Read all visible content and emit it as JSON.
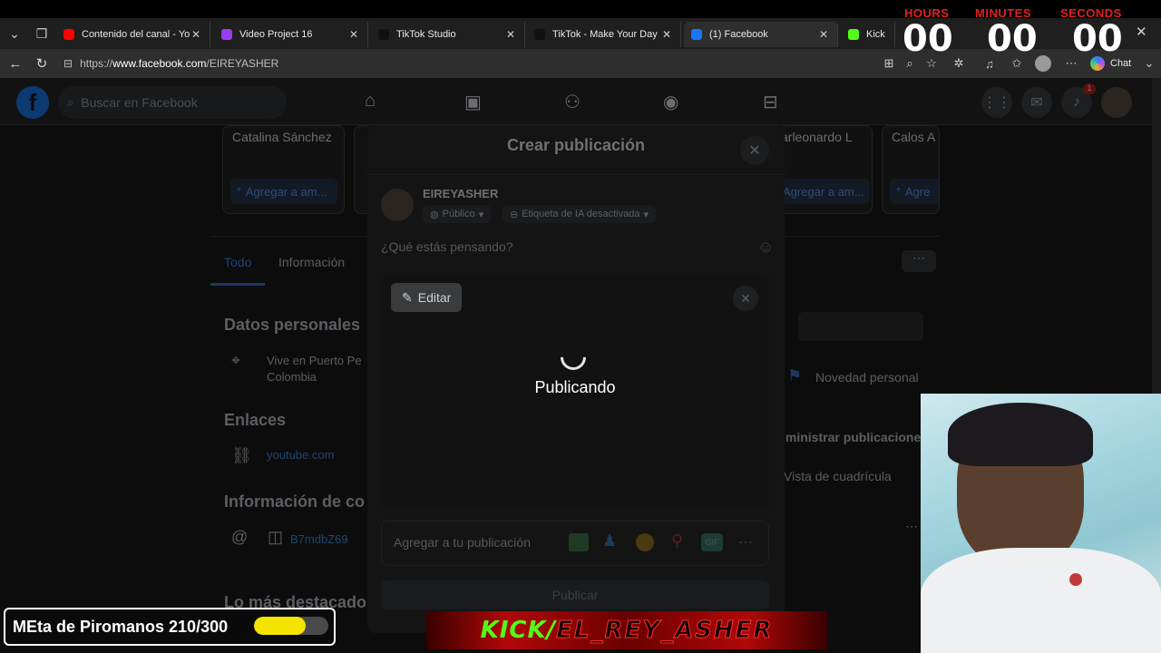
{
  "browser": {
    "tabs": [
      {
        "title": "Contenido del canal - YouTube",
        "favicon_color": "#ff0000",
        "favicon": "youtube-icon"
      },
      {
        "title": "Video Project 16",
        "favicon_color": "#9b3cf0",
        "favicon": "clapper-icon"
      },
      {
        "title": "TikTok Studio",
        "favicon_color": "#111111",
        "favicon": "tiktok-icon"
      },
      {
        "title": "TikTok - Make Your Day",
        "favicon_color": "#111111",
        "favicon": "tiktok-icon"
      },
      {
        "title": "(1) Facebook",
        "favicon_color": "#1877f2",
        "favicon": "facebook-icon"
      },
      {
        "title": "Kick",
        "favicon_color": "#53fc18",
        "favicon": "kick-icon"
      }
    ],
    "url_prefix": "https://",
    "url_host": "www.facebook.com",
    "url_path": "/EIREYASHER",
    "chat_label": "Chat"
  },
  "timer": {
    "hours_label": "HOURS",
    "minutes_label": "MINUTES",
    "seconds_label": "SECONDS",
    "hours": "00",
    "minutes": "00",
    "seconds": "00"
  },
  "facebook": {
    "search_placeholder": "Buscar en Facebook",
    "notification_count": "1",
    "friend_suggestions": [
      {
        "name": "Catalina Sánchez",
        "action": "Agregar a am..."
      },
      {
        "name": "arleonardo L",
        "action": "Agregar a am..."
      },
      {
        "name": "Calos A",
        "action": "Agre"
      }
    ],
    "profile_tabs": [
      "Todo",
      "Información"
    ],
    "personal_heading": "Datos personales",
    "lives_in": "Vive en Puerto Pe Colombia",
    "links_heading": "Enlaces",
    "link_youtube": "youtube.com",
    "contact_heading": "Información de co",
    "instagram": "B7mdbZ69",
    "highlights_heading": "Lo más destacado",
    "right_items": [
      "Novedad personal",
      "lministrar publicaciones",
      "Vista de cuadrícula"
    ]
  },
  "modal": {
    "title": "Crear publicación",
    "user_name": "EIREYASHER",
    "audience": "Público",
    "ai_label": "Etiqueta de IA desactivada",
    "prompt": "¿Qué estás pensando?",
    "edit_label": "Editar",
    "loading_text": "Publicando",
    "add_to_post": "Agregar a tu publicación",
    "publish_label": "Publicar"
  },
  "overlay": {
    "goal_text": "MEta de Piromanos 210/300",
    "goal_current": 210,
    "goal_total": 300,
    "kick_prefix": "KICK/",
    "kick_channel": "EL_REY_ASHER"
  }
}
